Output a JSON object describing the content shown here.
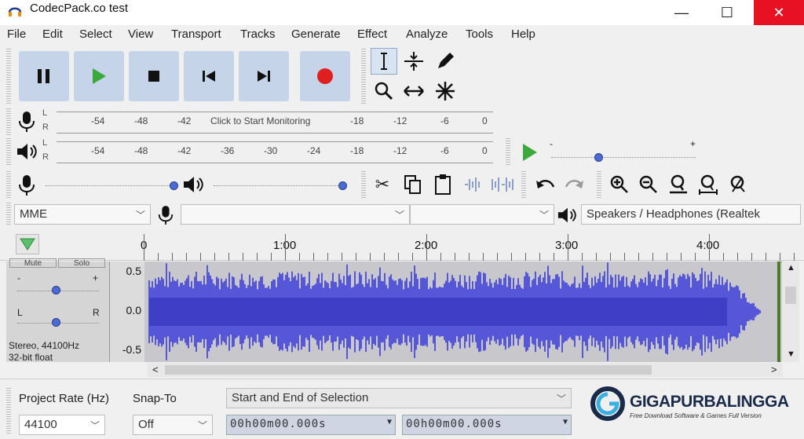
{
  "window": {
    "title": "CodecPack.co test",
    "minimize": "—",
    "maximize": "☐",
    "close": "✕"
  },
  "menu": [
    "File",
    "Edit",
    "Select",
    "View",
    "Transport",
    "Tracks",
    "Generate",
    "Effect",
    "Analyze",
    "Tools",
    "Help"
  ],
  "meters": {
    "record_ticks": [
      "-54",
      "-48",
      "-42",
      "-18",
      "-12",
      "-6",
      "0"
    ],
    "record_message": "Click to Start Monitoring",
    "play_ticks": [
      "-54",
      "-48",
      "-42",
      "-36",
      "-30",
      "-24",
      "-18",
      "-12",
      "-6",
      "0"
    ],
    "channel_l": "L",
    "channel_r": "R",
    "playback_speed_minus": "-",
    "playback_speed_plus": "+"
  },
  "devices": {
    "host": "MME",
    "recording_device": "",
    "recording_channels": "",
    "playback_device": "Speakers / Headphones (Realtek"
  },
  "timeline": {
    "labels": [
      "0",
      "1:00",
      "2:00",
      "3:00",
      "4:00"
    ]
  },
  "track": {
    "mute": "Mute",
    "solo": "Solo",
    "gain_minus": "-",
    "gain_plus": "+",
    "pan_left": "L",
    "pan_right": "R",
    "info_line1": "Stereo, 44100Hz",
    "info_line2": "32-bit float",
    "y_labels": [
      "0.5",
      "0.0",
      "-0.5"
    ]
  },
  "selection": {
    "project_rate_label": "Project Rate (Hz)",
    "project_rate_value": "44100",
    "snap_label": "Snap-To",
    "snap_value": "Off",
    "mode_value": "Start and End of Selection",
    "start_time": "00h00m00.000s",
    "end_time": "00h00m00.000s"
  },
  "logo": {
    "main": "GIGAPURBALINGGA",
    "sub": "Free Download Software & Games Full Version"
  },
  "colors": {
    "waveform": "#3a3adc",
    "transport_bg": "#c5d4e8",
    "record": "#e02020",
    "play": "#3aa83a",
    "close": "#e81123"
  }
}
